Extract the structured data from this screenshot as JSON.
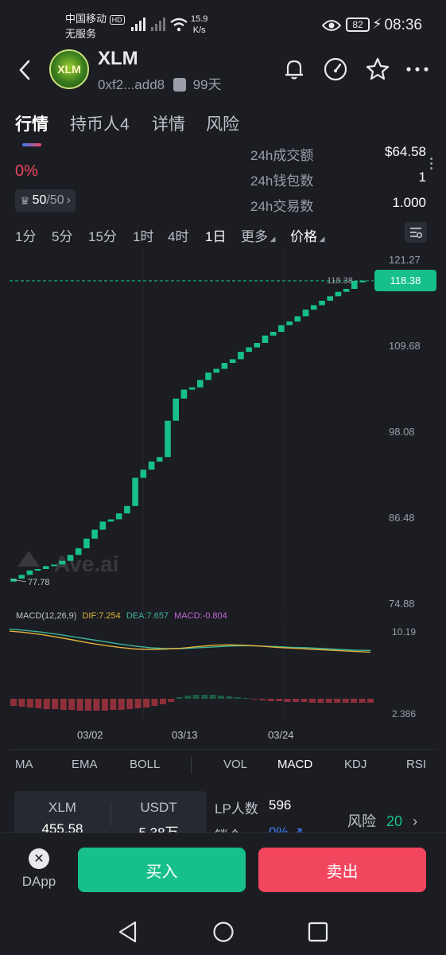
{
  "status_bar": {
    "carrier": "中国移动",
    "carrier_badge": "HD",
    "service": "无服务",
    "speed_value": "15.9",
    "speed_unit": "K/s",
    "battery": "82",
    "time": "08:36"
  },
  "header": {
    "token": "XLM",
    "avatar_text": "XLM",
    "address": "0xf2...add8",
    "age": "99天"
  },
  "tabs": [
    "行情",
    "持币人4",
    "详情",
    "风险"
  ],
  "price_change": "0%",
  "rank": {
    "value": "50",
    "total": "/50"
  },
  "stats": [
    {
      "label": "24h成交额",
      "value": "$64.58"
    },
    {
      "label": "24h钱包数",
      "value": "1"
    },
    {
      "label": "24h交易数",
      "value": "1.000"
    }
  ],
  "timeframes": [
    "1分",
    "5分",
    "15分",
    "1时",
    "4时",
    "1日",
    "更多",
    "价格"
  ],
  "chart": {
    "watermark": "Ave.ai",
    "price_axis": [
      "121.27",
      "109.68",
      "98.08",
      "86.48",
      "74.88"
    ],
    "current_price": "118.38",
    "current_price_line_label": "118.38",
    "low_label": "77.78",
    "macd_legend": {
      "name": "MACD(12,26,9)",
      "dif": "DIF:7.254",
      "dea": "DEA:7.657",
      "macd": "MACD:-0.804"
    },
    "macd_axis": [
      "10.19",
      "2.386"
    ],
    "dates": [
      "03/02",
      "03/13",
      "03/24"
    ],
    "colors": {
      "up": "#17c08a",
      "down": "#f2455e",
      "dif": "#e2b23a",
      "dea": "#3fb39a",
      "macd": "#c266d8",
      "bar_neg": "#8f2f3b",
      "bar_pos": "#1e5c46"
    }
  },
  "chart_data": {
    "type": "candlestick",
    "ylim": [
      74.88,
      121.27
    ],
    "candles": [
      {
        "o": 77.8,
        "c": 78.2
      },
      {
        "o": 78.2,
        "c": 78.7
      },
      {
        "o": 78.7,
        "c": 79.3
      },
      {
        "o": 79.3,
        "c": 79.5
      },
      {
        "o": 79.5,
        "c": 79.9
      },
      {
        "o": 79.9,
        "c": 80.1
      },
      {
        "o": 80.1,
        "c": 80.6
      },
      {
        "o": 80.6,
        "c": 81.4
      },
      {
        "o": 81.4,
        "c": 82.3
      },
      {
        "o": 82.3,
        "c": 83.6
      },
      {
        "o": 83.6,
        "c": 84.8
      },
      {
        "o": 84.8,
        "c": 85.9
      },
      {
        "o": 85.9,
        "c": 86.2
      },
      {
        "o": 86.2,
        "c": 87.0
      },
      {
        "o": 87.0,
        "c": 88.0
      },
      {
        "o": 88.0,
        "c": 91.8
      },
      {
        "o": 91.8,
        "c": 92.9
      },
      {
        "o": 92.9,
        "c": 94.0
      },
      {
        "o": 94.0,
        "c": 94.6
      },
      {
        "o": 94.6,
        "c": 99.5
      },
      {
        "o": 99.5,
        "c": 102.5
      },
      {
        "o": 102.5,
        "c": 103.7
      },
      {
        "o": 103.7,
        "c": 104.0
      },
      {
        "o": 104.0,
        "c": 105.0
      },
      {
        "o": 105.0,
        "c": 106.0
      },
      {
        "o": 106.0,
        "c": 106.5
      },
      {
        "o": 106.5,
        "c": 107.3
      },
      {
        "o": 107.3,
        "c": 107.8
      },
      {
        "o": 107.8,
        "c": 108.8
      },
      {
        "o": 108.8,
        "c": 109.4
      },
      {
        "o": 109.4,
        "c": 110.0
      },
      {
        "o": 110.0,
        "c": 111.0
      },
      {
        "o": 111.0,
        "c": 111.5
      },
      {
        "o": 111.5,
        "c": 112.4
      },
      {
        "o": 112.4,
        "c": 112.9
      },
      {
        "o": 112.9,
        "c": 113.6
      },
      {
        "o": 113.6,
        "c": 114.5
      },
      {
        "o": 114.5,
        "c": 115.1
      },
      {
        "o": 115.1,
        "c": 115.7
      },
      {
        "o": 115.7,
        "c": 116.3
      },
      {
        "o": 116.3,
        "c": 116.9
      },
      {
        "o": 116.9,
        "c": 117.3
      },
      {
        "o": 117.3,
        "c": 118.38
      },
      {
        "o": 118.38,
        "c": 118.4
      }
    ],
    "macd_hist": [
      -0.9,
      -1.0,
      -1.1,
      -1.2,
      -1.3,
      -1.3,
      -1.4,
      -1.4,
      -1.5,
      -1.5,
      -1.5,
      -1.5,
      -1.4,
      -1.4,
      -1.3,
      -1.2,
      -1.1,
      -0.9,
      -0.7,
      -0.4,
      0.2,
      0.4,
      0.5,
      0.5,
      0.5,
      0.4,
      0.3,
      0.2,
      0.1,
      -0.1,
      -0.2,
      -0.3,
      -0.3,
      -0.4,
      -0.4,
      -0.4,
      -0.5,
      -0.5,
      -0.5,
      -0.5,
      -0.5,
      -0.5,
      -0.5,
      -0.5
    ],
    "dif": [
      12.3,
      12.0,
      11.5,
      10.9,
      10.2,
      9.5,
      8.9,
      8.4,
      8.0,
      7.9,
      8.0,
      8.2,
      8.6,
      8.9,
      9.0,
      8.9,
      8.7,
      8.4,
      8.2,
      8.0,
      7.8,
      7.6,
      7.4,
      7.254
    ],
    "dea": [
      12.8,
      12.5,
      12.1,
      11.6,
      11.0,
      10.4,
      9.8,
      9.2,
      8.7,
      8.3,
      8.1,
      8.1,
      8.3,
      8.5,
      8.7,
      8.8,
      8.7,
      8.6,
      8.4,
      8.3,
      8.1,
      7.9,
      7.7,
      7.657
    ]
  },
  "indicators": [
    "MA",
    "EMA",
    "BOLL",
    "VOL",
    "MACD",
    "KDJ",
    "RSI"
  ],
  "pair": {
    "base": "XLM",
    "base_amount": "455.58",
    "quote": "USDT",
    "quote_amount": "5.38万"
  },
  "lp": {
    "label": "LP人数",
    "value": "596",
    "lock_label": "锁仓",
    "lock_value": "0%"
  },
  "risk": {
    "label": "风险",
    "value": "20"
  },
  "bottom": {
    "dapp": "DApp",
    "buy": "买入",
    "sell": "卖出"
  }
}
